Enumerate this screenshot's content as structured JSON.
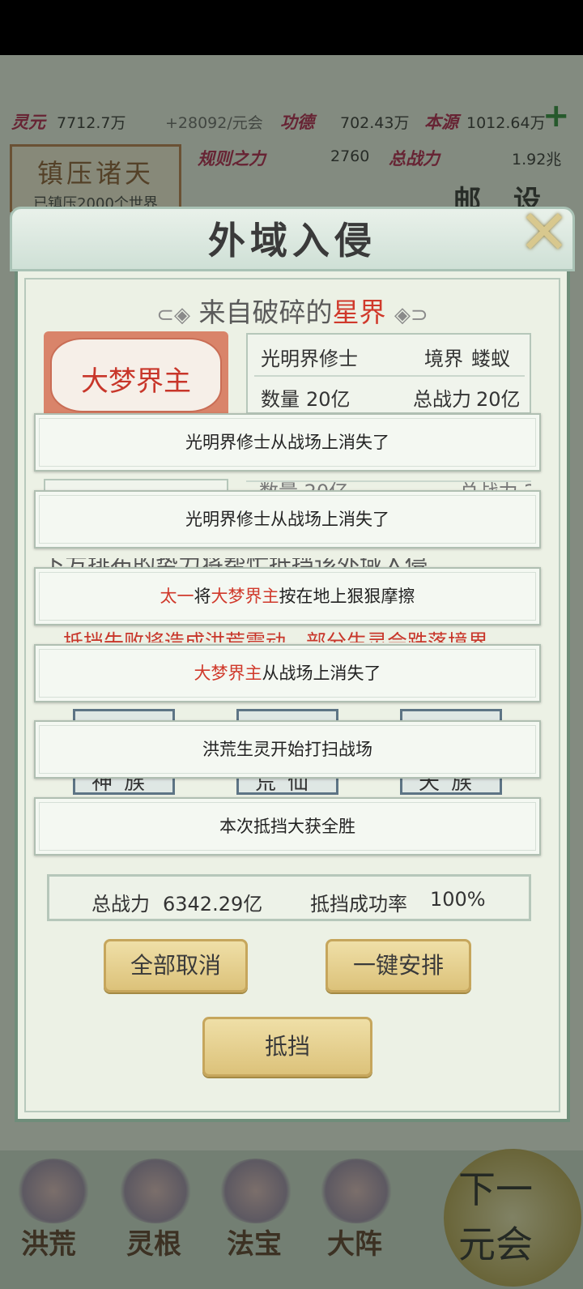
{
  "background": {
    "resources": {
      "lingyuan_label": "灵元",
      "lingyuan_value": "7712.7万",
      "lingyuan_rate": "+28092/元会",
      "gongde_label": "功德",
      "gongde_value": "702.43万",
      "benyuan_label": "本源",
      "benyuan_value": "1012.64万",
      "plus": "+"
    },
    "panel": {
      "title": "镇压诸天",
      "subtitle": "已镇压2000个世界"
    },
    "row2": {
      "guize_label": "规则之力",
      "guize_value": "2760",
      "zongzhanli_label": "总战力",
      "zongzhanli_value": "1.92兆",
      "mail": "邮",
      "settings": "设"
    },
    "nav": {
      "items": [
        "洪荒",
        "灵根",
        "法宝",
        "大阵"
      ],
      "next_line1": "下一",
      "next_line2": "元会"
    }
  },
  "dialog": {
    "title": "外域入侵",
    "close_icon": "✕",
    "subtitle_prefix": "来自破碎的",
    "subtitle_highlight": "星界",
    "boss_name": "大梦界主",
    "enemy": {
      "name": "光明界修士",
      "realm_label": "境界",
      "realm_value": "蝼蚁",
      "count_label": "数量",
      "count_value": "20亿",
      "power_label": "总战力",
      "power_value": "20亿"
    },
    "ghost_row": "数量 20亿                  总战力 20亿",
    "ghost_text1": "下方排布的势力将帮忙抵挡该外域入侵",
    "ghost_text2": "抵挡失败将造成洪荒震动，部分生灵会跌落境界",
    "slots": [
      {
        "glyphs": "神族"
      },
      {
        "glyphs": "荒仙"
      },
      {
        "glyphs": "天族"
      }
    ],
    "total_power_label": "总战力",
    "total_power_value": "6342.29亿",
    "success_label": "抵挡成功率",
    "success_value": "100%",
    "buttons": {
      "cancel_all": "全部取消",
      "auto_arrange": "一键安排",
      "block": "抵挡"
    }
  },
  "toasts": [
    {
      "parts": [
        {
          "t": "光明界修士从战场上消失了",
          "c": "n"
        }
      ]
    },
    {
      "parts": [
        {
          "t": "光明界修士从战场上消失了",
          "c": "n"
        }
      ]
    },
    {
      "parts": [
        {
          "t": "太一",
          "c": "r"
        },
        {
          "t": "将",
          "c": "n"
        },
        {
          "t": "大梦界主",
          "c": "r"
        },
        {
          "t": "按在地上狠狠摩擦",
          "c": "n"
        }
      ]
    },
    {
      "parts": [
        {
          "t": "大梦界主",
          "c": "r"
        },
        {
          "t": "从战场上消失了",
          "c": "n"
        }
      ]
    },
    {
      "parts": [
        {
          "t": "洪荒生灵开始打扫战场",
          "c": "n"
        }
      ]
    },
    {
      "parts": [
        {
          "t": "本次抵挡大获全胜",
          "c": "n"
        }
      ]
    }
  ],
  "colors": {
    "highlight_red": "#d0392b",
    "gold_button": "#dcc27a"
  }
}
